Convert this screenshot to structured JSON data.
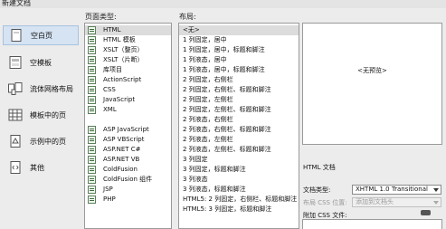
{
  "window": {
    "title": "新建文档"
  },
  "categories": [
    {
      "label": "空白页",
      "icon": "blank-page-icon"
    },
    {
      "label": "空模板",
      "icon": "blank-template-icon"
    },
    {
      "label": "流体网格布局",
      "icon": "fluid-grid-icon"
    },
    {
      "label": "模板中的页",
      "icon": "template-page-icon"
    },
    {
      "label": "示例中的页",
      "icon": "sample-page-icon"
    },
    {
      "label": "其他",
      "icon": "other-icon"
    }
  ],
  "page_type": {
    "label": "页面类型:",
    "items": [
      "HTML",
      "HTML 模板",
      "XSLT（整页）",
      "XSLT（片断）",
      "库项目",
      "ActionScript",
      "CSS",
      "JavaScript",
      "XML",
      "",
      "ASP JavaScript",
      "ASP VBScript",
      "ASP.NET C#",
      "ASP.NET VB",
      "ColdFusion",
      "ColdFusion 组件",
      "JSP",
      "PHP"
    ]
  },
  "layout": {
    "label": "布局:",
    "items": [
      "<无>",
      "1 列固定，居中",
      "1 列固定，居中，标题和脚注",
      "1 列液态，居中",
      "1 列液态，居中，标题和脚注",
      "2 列固定，右侧栏",
      "2 列固定，右侧栏、标题和脚注",
      "2 列固定，左侧栏",
      "2 列固定，左侧栏、标题和脚注",
      "2 列液态，右侧栏",
      "2 列液态，右侧栏、标题和脚注",
      "2 列液态，左侧栏",
      "2 列液态，左侧栏、标题和脚注",
      "3 列固定",
      "3 列固定，标题和脚注",
      "3 列液态",
      "3 列液态，标题和脚注",
      "HTML5: 2 列固定，右侧栏、标题和脚注",
      "HTML5: 3 列固定，标题和脚注"
    ]
  },
  "preview": {
    "text": "<无预览>"
  },
  "description": "HTML 文档",
  "doctype": {
    "label": "文档类型:",
    "value": "XHTML 1.0 Transitional"
  },
  "css_position": {
    "label": "布局 CSS 位置:",
    "value": "添加到文档头"
  },
  "attach_css": {
    "label": "附加 CSS 文件:"
  }
}
